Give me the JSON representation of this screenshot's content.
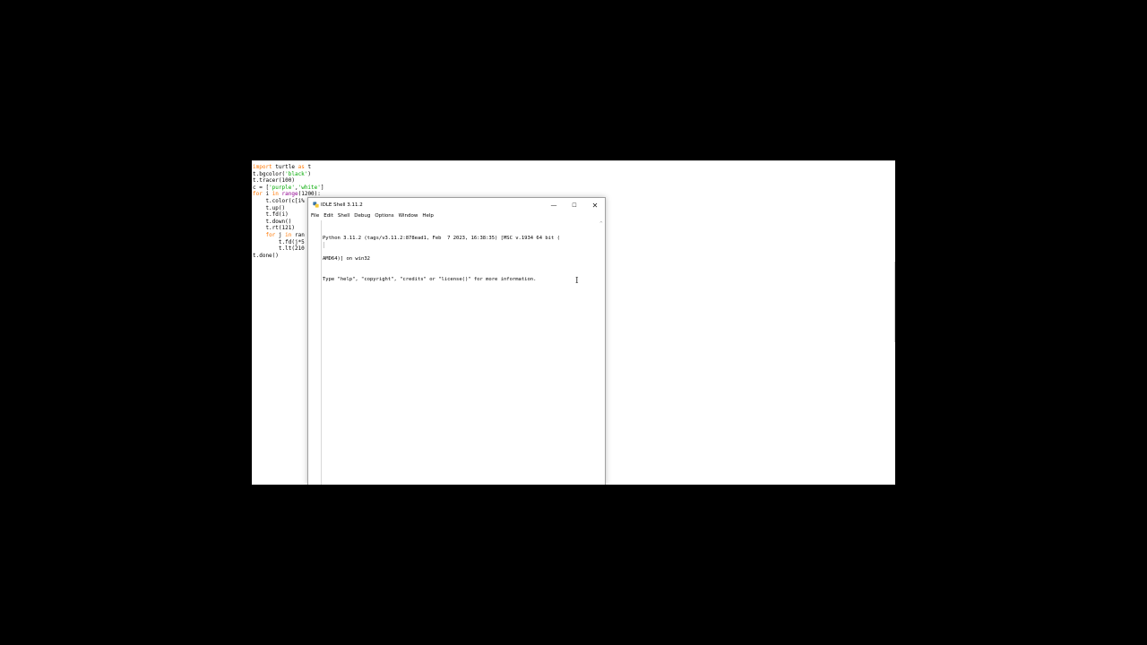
{
  "editor": {
    "code_lines": [
      [
        {
          "t": "import",
          "c": "kw"
        },
        {
          "t": " turtle "
        },
        {
          "t": "as",
          "c": "kw"
        },
        {
          "t": " t"
        }
      ],
      [
        {
          "t": "t.bgcolor("
        },
        {
          "t": "'black'",
          "c": "st"
        },
        {
          "t": ")"
        }
      ],
      [
        {
          "t": "t.tracer(100)"
        }
      ],
      [
        {
          "t": "c = ["
        },
        {
          "t": "'purple'",
          "c": "st"
        },
        {
          "t": ","
        },
        {
          "t": "'white'",
          "c": "st"
        },
        {
          "t": "]"
        }
      ],
      [
        {
          "t": "for",
          "c": "kw"
        },
        {
          "t": " i "
        },
        {
          "t": "in",
          "c": "kw"
        },
        {
          "t": " "
        },
        {
          "t": "range",
          "c": "bi"
        },
        {
          "t": "(1200):"
        }
      ],
      [
        {
          "t": "    t.color(c[i%"
        }
      ],
      [
        {
          "t": "    t.up()"
        }
      ],
      [
        {
          "t": "    t.fd(i)"
        }
      ],
      [
        {
          "t": "    t.down()"
        }
      ],
      [
        {
          "t": "    t.rt(121)"
        }
      ],
      [
        {
          "t": "    "
        },
        {
          "t": "for",
          "c": "kw"
        },
        {
          "t": " j "
        },
        {
          "t": "in",
          "c": "kw"
        },
        {
          "t": " ran"
        }
      ],
      [
        {
          "t": "        t.fd(j*5"
        }
      ],
      [
        {
          "t": "        t.lt(210"
        }
      ],
      [
        {
          "t": "t.done()"
        }
      ]
    ]
  },
  "shell": {
    "title": "IDLE Shell 3.11.2",
    "controls": {
      "minimize": "—",
      "maximize": "☐",
      "close": "✕"
    },
    "menu": [
      "File",
      "Edit",
      "Shell",
      "Debug",
      "Options",
      "Window",
      "Help"
    ],
    "output_lines": [
      "Python 3.11.2 (tags/v3.11.2:878ead1, Feb  7 2023, 16:38:35) [MSC v.1934 64 bit (",
      "AMD64)] on win32",
      "Type \"help\", \"copyright\", \"credits\" or \"license()\" for more information."
    ],
    "scroll_arrow": "^"
  },
  "cursor": {
    "ibeam": "I"
  }
}
